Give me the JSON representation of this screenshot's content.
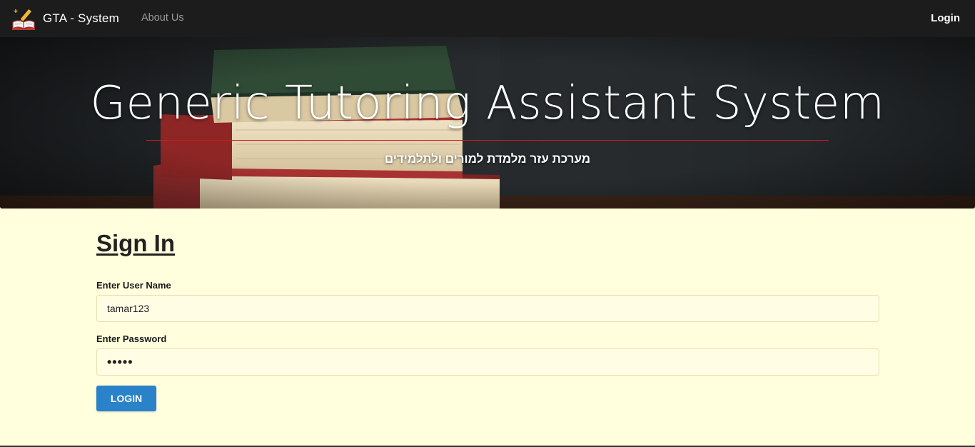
{
  "navbar": {
    "brand": "GTA - System",
    "about_link": "About Us",
    "login_link": "Login"
  },
  "hero": {
    "title": "Generic Tutoring Assistant System",
    "subtitle": "מערכת עזר מלמדת למורים ולתלמידים"
  },
  "signin": {
    "title": "Sign In",
    "username_label": "Enter User Name",
    "username_value": "tamar123",
    "password_label": "Enter Password",
    "password_value": "•••••",
    "login_button": "LOGIN"
  },
  "colors": {
    "navbar": "#1c1c1c",
    "page_background": "#fffedd",
    "accent_rule": "#c81e1e",
    "button": "#2a82c9"
  },
  "icons": {
    "brand_logo": "book-pencil-icon"
  }
}
